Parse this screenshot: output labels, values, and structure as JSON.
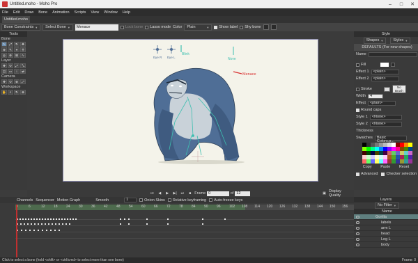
{
  "window": {
    "title": "Untitled.moho - Moho Pro"
  },
  "menu": [
    "File",
    "Edit",
    "Draw",
    "Bone",
    "Animation",
    "Scripts",
    "View",
    "Window",
    "Help"
  ],
  "doc_tab": "Untitled.moho",
  "toolbar": {
    "bone_constraints": "Bone Constraints",
    "select_bone": "Select Bone",
    "bone_name": "Menace",
    "lock_bone": "Lock bone",
    "lasso_mode": "Lasso mode",
    "color_label": "Color",
    "color_value": "Plain",
    "show_label": "Show label",
    "shy_bone": "Shy bone"
  },
  "tools": {
    "title": "Tools",
    "sections": [
      "Bone",
      "Layer",
      "Camera",
      "Workspace"
    ],
    "bone_icons": [
      "↖",
      "⤢",
      "↻",
      "✥",
      "⊕",
      "✎",
      "⌖",
      "⚲",
      "◎",
      "⊗",
      "⊞",
      "∿"
    ],
    "layer_icons": [
      "✥",
      "↻",
      "⤢",
      "⤡",
      "◫",
      "▭",
      "↕",
      "⇄"
    ],
    "camera_icons": [
      "✥",
      "↻",
      "⊕",
      "⤢"
    ],
    "workspace_icons": [
      "✋",
      "⌕",
      "↻",
      "⊕"
    ]
  },
  "viewport": {
    "labels": {
      "eye_r": "Eye R",
      "eye_l": "Eye L",
      "blink": "Blink",
      "nose": "Nove",
      "menace": "Menace"
    }
  },
  "playback": {
    "frame_label": "Frame",
    "frame_value": "0",
    "of_label": "of",
    "total_frames": "12",
    "display_quality": "Display Quality"
  },
  "style": {
    "title": "Style",
    "shapes": "Shapes",
    "styles": "Styles",
    "defaults": "DEFAULTS (For new shapes)",
    "name_label": "Name",
    "fill_label": "Fill",
    "effect1_label": "Effect 1",
    "effect1_value": "<plain>",
    "effect2_label": "Effect 2",
    "effect2_value": "<plain>",
    "stroke_label": "Stroke",
    "width_label": "Width",
    "width_value": "4",
    "no_brush": "No Brush",
    "effect_label": "Effect",
    "effect_value": "<plain>",
    "round_caps": "Round caps",
    "style1_label": "Style 1",
    "style1_value": "<None>",
    "style2_label": "Style 2",
    "style2_value": "<None>",
    "thickness_label": "Thickness",
    "swatches_label": "Swatches",
    "swatches_value": "Basic Colors.p...",
    "copy": "Copy",
    "paste": "Paste",
    "reset": "Reset",
    "advanced": "Advanced",
    "checker": "Checker selection"
  },
  "timeline": {
    "tabs": [
      "Channels",
      "Sequencer",
      "Motion Graph"
    ],
    "smooth": "Smooth",
    "step": "1",
    "onion": "Onion Skins",
    "relative": "Relative keyframing",
    "autofreeze": "Auto-freeze keys",
    "ruler": [
      "0",
      "6",
      "12",
      "18",
      "24",
      "30",
      "36",
      "42",
      "48",
      "54",
      "60",
      "66",
      "72",
      "78",
      "84",
      "90",
      "96",
      "102",
      "108",
      "114",
      "120",
      "126",
      "132",
      "138",
      "144",
      "150",
      "156"
    ]
  },
  "layers": {
    "title": "Layers",
    "filter": "No Filter",
    "name_col": "Name",
    "items": [
      {
        "name": "Gorilla",
        "sel": true,
        "indent": 0
      },
      {
        "name": "labels",
        "sel": false,
        "indent": 1
      },
      {
        "name": "arm L",
        "sel": false,
        "indent": 1
      },
      {
        "name": "head",
        "sel": false,
        "indent": 1
      },
      {
        "name": "Leg L",
        "sel": false,
        "indent": 1
      },
      {
        "name": "body",
        "sel": false,
        "indent": 1
      }
    ]
  },
  "status": {
    "text": "Click to select a bone (hold <shift> or <ctrl/cmd> to select more than one bone)",
    "frame": "Frame: 0"
  },
  "colors": {
    "accent": "#5f7f7f",
    "gorilla_dark": "#4f6e96",
    "gorilla_light": "#c9d2d9",
    "bone": "#3dbfb0",
    "menace": "#d83030",
    "stage_border": "#8a8ab0"
  }
}
